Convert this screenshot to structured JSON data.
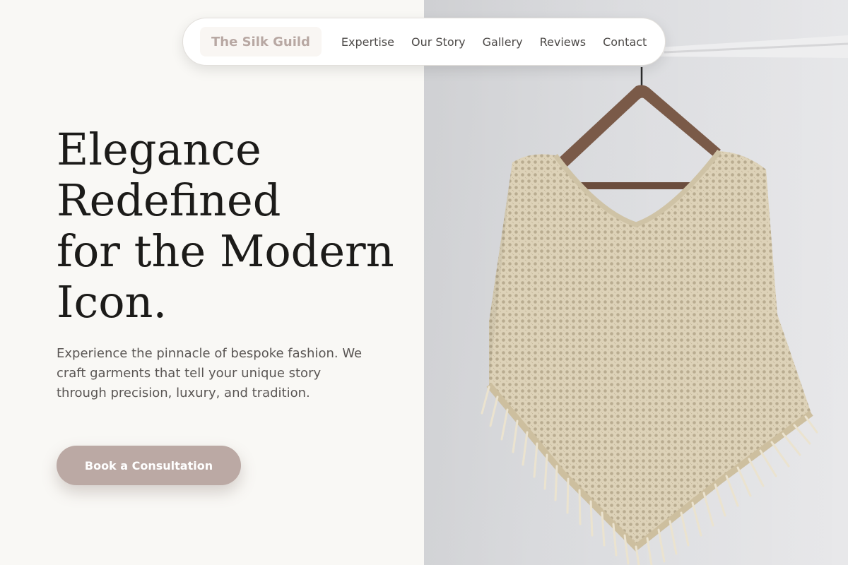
{
  "nav": {
    "brand": "The Silk Guild",
    "links": [
      "Expertise",
      "Our Story",
      "Gallery",
      "Reviews",
      "Contact"
    ]
  },
  "hero": {
    "title_lines": [
      "Elegance",
      "Redefined",
      "for the Modern",
      "Icon."
    ],
    "description": "Experience the pinnacle of bespoke fashion. We craft garments that tell your unique story through precision, luxury, and tradition.",
    "cta_label": "Book a Consultation"
  },
  "colors": {
    "page_background": "#f9f8f5",
    "brand_text": "#b8a8a3",
    "accent_button": "#bba9a4",
    "heading_text": "#1c1b19",
    "body_text": "#5a5654",
    "photo_backdrop": "#e3e4e7",
    "poncho": "#dfd5bd",
    "hanger": "#7a5a48"
  },
  "media": {
    "hero_photo": "knit-poncho-on-hanger-photo"
  }
}
